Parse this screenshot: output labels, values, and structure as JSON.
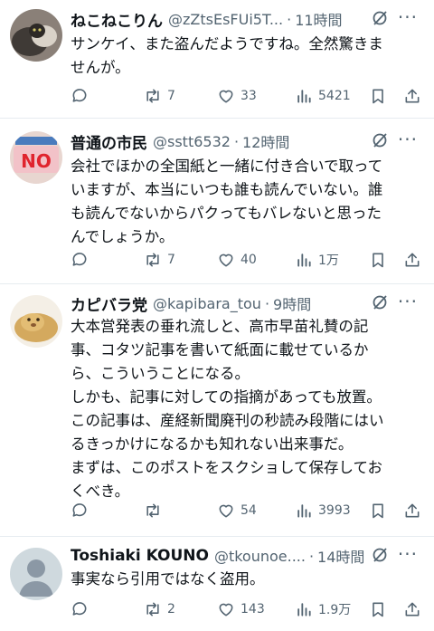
{
  "posts": [
    {
      "name": "ねこねこりん",
      "handle": "@zZtsEsFUi5T...",
      "time": "11時間",
      "body": "サンケイ、また盗んだようですね。全然驚きま\nせんが。",
      "replies": "",
      "reposts": "7",
      "likes": "33",
      "views": "5421"
    },
    {
      "name": "普通の市民",
      "handle": "@sstt6532",
      "time": "12時間",
      "body": "会社でほかの全国紙と一緒に付き合いで取って\nいますが、本当にいつも誰も読んでいない。誰\nも読んでないからパクってもバレないと思った\nんでしょうか。",
      "replies": "",
      "reposts": "7",
      "likes": "40",
      "views": "1万"
    },
    {
      "name": "カピバラ党",
      "handle": "@kapibara_tou",
      "time": "9時間",
      "body": "大本営発表の垂れ流しと、高市早苗礼賛の記\n事、コタツ記事を書いて紙面に載せているか\nら、こういうことになる。\nしかも、記事に対しての指摘があっても放置。\nこの記事は、産経新聞廃刊の秒読み段階にはい\nるきっかけになるかも知れない出来事だ。\nまずは、このポストをスクショして保存してお\nくべき。",
      "replies": "",
      "reposts": "",
      "likes": "54",
      "views": "3993"
    },
    {
      "name": "Toshiaki KOUNO",
      "handle": "@tkounoe....",
      "time": "14時間",
      "body": "事実なら引用ではなく盗用。",
      "replies": "",
      "reposts": "2",
      "likes": "143",
      "views": "1.9万"
    }
  ],
  "separator": "·",
  "more_label": "···",
  "colors": {
    "text": "#0f1419",
    "secondary": "#536471",
    "divider": "#e6ecf0"
  },
  "icons": [
    "reply-icon",
    "repost-icon",
    "like-icon",
    "views-icon",
    "bookmark-icon",
    "share-icon",
    "grok-icon"
  ]
}
